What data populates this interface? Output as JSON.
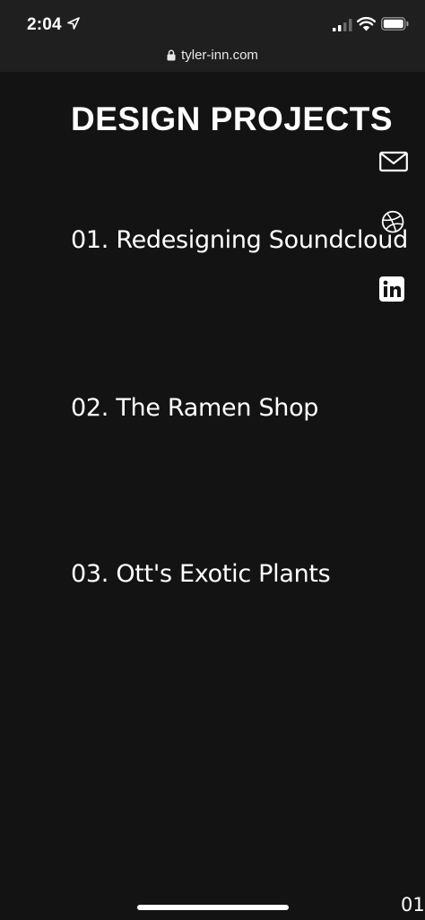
{
  "status_bar": {
    "time": "2:04",
    "icons": [
      "location-arrow-icon",
      "cellular-signal-icon",
      "wifi-icon",
      "battery-icon"
    ]
  },
  "browser": {
    "url": "tyler-inn.com",
    "lock_icon": "lock-icon"
  },
  "page": {
    "title": "DESIGN PROJECTS",
    "projects": [
      {
        "label": "01. Redesigning Soundcloud"
      },
      {
        "label": "02. The Ramen Shop"
      },
      {
        "label": "03. Ott's Exotic Plants"
      }
    ],
    "social_icons": [
      "mail-icon",
      "dribbble-icon",
      "linkedin-icon"
    ],
    "page_indicator": "01"
  },
  "colors": {
    "background": "#131313",
    "status_bar": "#1f1f1f",
    "text": "#ffffff"
  }
}
